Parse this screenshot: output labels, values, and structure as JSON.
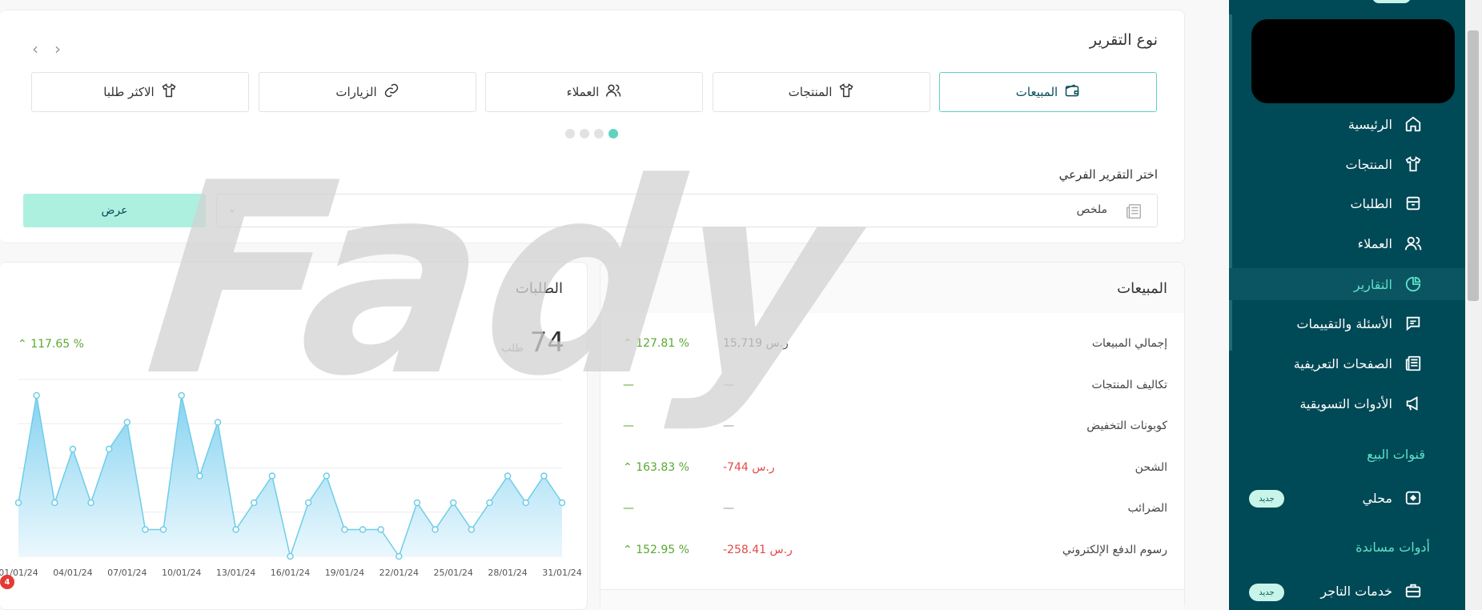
{
  "sidebar": {
    "items": [
      {
        "label": "الرئيسية",
        "icon": "home-icon"
      },
      {
        "label": "المنتجات",
        "icon": "shirt-icon"
      },
      {
        "label": "الطلبات",
        "icon": "box-icon"
      },
      {
        "label": "العملاء",
        "icon": "users-icon"
      },
      {
        "label": "التقارير",
        "icon": "pie-chart-icon",
        "active": true
      },
      {
        "label": "الأسئلة والتقييمات",
        "icon": "comment-icon"
      },
      {
        "label": "الصفحات التعريفية",
        "icon": "newspaper-icon"
      },
      {
        "label": "الأدوات التسويقية",
        "icon": "megaphone-icon"
      }
    ],
    "sales_channels_title": "قنوات البيع",
    "local_label": "محلي",
    "local_badge": "جديد",
    "support_tools_title": "أدوات مساندة",
    "merchant_services_label": "خدمات التاجر",
    "merchant_badge": "جديد"
  },
  "report": {
    "title": "نوع التقرير",
    "tabs": [
      {
        "label": "المبيعات",
        "icon": "wallet-icon",
        "active": true
      },
      {
        "label": "المنتجات",
        "icon": "shirt-icon"
      },
      {
        "label": "العملاء",
        "icon": "users-icon"
      },
      {
        "label": "الزيارات",
        "icon": "link-icon"
      },
      {
        "label": "الاكثر طلبا",
        "icon": "shirt-icon"
      }
    ],
    "sub_label": "اختر التقرير الفرعي",
    "sub_value": "ملخص",
    "show_button": "عرض"
  },
  "sales": {
    "title": "المبيعات",
    "rows": [
      {
        "label": "إجمالي المبيعات",
        "amount": "15,719 ر.س",
        "change": "127.81 %"
      },
      {
        "label": "تكاليف المنتجات",
        "amount": "—",
        "change": "—"
      },
      {
        "label": "كوبونات التخفيض",
        "amount": "—",
        "change": "—"
      },
      {
        "label": "الشحن",
        "amount": "-744 ر.س",
        "change": "163.83 %"
      },
      {
        "label": "الضرائب",
        "amount": "—",
        "change": "—"
      },
      {
        "label": "رسوم الدفع الإلكتروني",
        "amount": "-258.41 ر.س",
        "change": "152.95 %"
      }
    ]
  },
  "orders": {
    "title": "الطلبات",
    "count": "74",
    "unit": "طلب",
    "change": "117.65 %"
  },
  "chart_data": {
    "type": "area",
    "x": [
      "01/01/24",
      "02/01/24",
      "03/01/24",
      "04/01/24",
      "05/01/24",
      "06/01/24",
      "07/01/24",
      "08/01/24",
      "09/01/24",
      "10/01/24",
      "11/01/24",
      "12/01/24",
      "13/01/24",
      "14/01/24",
      "15/01/24",
      "16/01/24",
      "17/01/24",
      "18/01/24",
      "19/01/24",
      "20/01/24",
      "21/01/24",
      "22/01/24",
      "23/01/24",
      "24/01/24",
      "25/01/24",
      "26/01/24",
      "27/01/24",
      "28/01/24",
      "29/01/24",
      "30/01/24",
      "31/01/24"
    ],
    "tick_labels": [
      "01/01/24",
      "04/01/24",
      "07/01/24",
      "10/01/24",
      "13/01/24",
      "16/01/24",
      "19/01/24",
      "22/01/24",
      "25/01/24",
      "28/01/24",
      "31/01/24"
    ],
    "values": [
      2,
      6,
      2,
      4,
      2,
      4,
      5,
      1,
      1,
      6,
      3,
      5,
      1,
      2,
      3,
      0,
      2,
      3,
      1,
      1,
      1,
      0,
      2,
      1,
      2,
      1,
      2,
      3,
      2,
      3,
      2
    ],
    "ylim": [
      0,
      8
    ],
    "grid": true,
    "fill_color": "#8fd8f2",
    "line_color": "#6fcde8"
  },
  "notification_count": "4",
  "watermark": "Fady",
  "colors": {
    "sidebar_bg": "#004956",
    "accent": "#5fe0c9",
    "positive": "#5aa832",
    "negative": "#e54848"
  }
}
